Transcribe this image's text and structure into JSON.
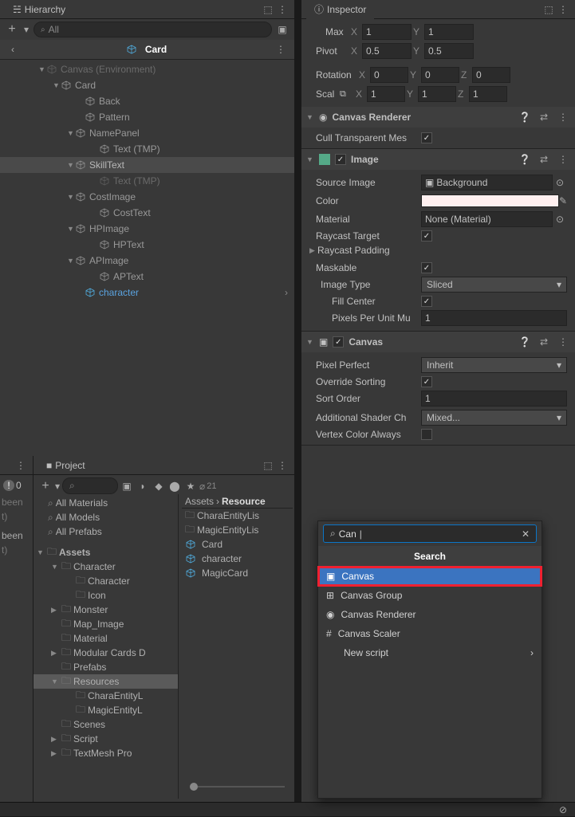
{
  "hierarchy": {
    "title": "Hierarchy",
    "search_placeholder": "All",
    "breadcrumb": "Card",
    "nodes": [
      {
        "label": "Canvas (Environment)",
        "indent": 48,
        "fold": true,
        "dim": true
      },
      {
        "label": "Card",
        "indent": 66,
        "fold": true
      },
      {
        "label": "Back",
        "indent": 96
      },
      {
        "label": "Pattern",
        "indent": 96
      },
      {
        "label": "NamePanel",
        "indent": 84,
        "fold": true
      },
      {
        "label": "Text (TMP)",
        "indent": 114
      },
      {
        "label": "SkillText",
        "indent": 84,
        "fold": true,
        "sel": true
      },
      {
        "label": "Text (TMP)",
        "indent": 114,
        "dim": true
      },
      {
        "label": "CostImage",
        "indent": 84,
        "fold": true
      },
      {
        "label": "CostText",
        "indent": 114
      },
      {
        "label": "HPImage",
        "indent": 84,
        "fold": true
      },
      {
        "label": "HPText",
        "indent": 114
      },
      {
        "label": "APImage",
        "indent": 84,
        "fold": true
      },
      {
        "label": "APText",
        "indent": 114
      },
      {
        "label": "character",
        "indent": 96,
        "active": true,
        "arrow": true
      }
    ]
  },
  "inspector": {
    "title": "Inspector",
    "transform": {
      "max_label": "Max",
      "x_label": "X",
      "y_label": "Y",
      "z_label": "Z",
      "max_x": "1",
      "max_y": "1",
      "pivot_label": "Pivot",
      "pivot_x": "0.5",
      "pivot_y": "0.5",
      "rotation_label": "Rotation",
      "rot_x": "0",
      "rot_y": "0",
      "rot_z": "0",
      "scale_label": "Scal",
      "scale_x": "1",
      "scale_y": "1",
      "scale_z": "1"
    },
    "canvas_renderer": {
      "title": "Canvas Renderer",
      "cull_label": "Cull Transparent Mes",
      "cull": true
    },
    "image": {
      "title": "Image",
      "source_image_label": "Source Image",
      "source_image": "Background",
      "color_label": "Color",
      "material_label": "Material",
      "material": "None (Material)",
      "raycast_target_label": "Raycast Target",
      "raycast_target": true,
      "raycast_padding_label": "Raycast Padding",
      "maskable_label": "Maskable",
      "maskable": true,
      "image_type_label": "Image Type",
      "image_type": "Sliced",
      "fill_center_label": "Fill Center",
      "fill_center": true,
      "ppum_label": "Pixels Per Unit Mu",
      "ppum": "1"
    },
    "canvas": {
      "title": "Canvas",
      "pixel_perfect_label": "Pixel Perfect",
      "pixel_perfect": "Inherit",
      "override_sorting_label": "Override Sorting",
      "override_sorting": true,
      "sort_order_label": "Sort Order",
      "sort_order": "1",
      "additional_shader_label": "Additional Shader Ch",
      "additional_shader": "Mixed...",
      "vertex_color_label": "Vertex Color Always"
    }
  },
  "search_popup": {
    "query": "Can",
    "header": "Search",
    "items": [
      {
        "label": "Canvas",
        "hl": true,
        "icon": "canvas"
      },
      {
        "label": "Canvas Group",
        "icon": "grid"
      },
      {
        "label": "Canvas Renderer",
        "icon": "eye"
      },
      {
        "label": "Canvas Scaler",
        "icon": "script"
      },
      {
        "label": "New script",
        "arrow": true
      }
    ]
  },
  "project": {
    "title": "Project",
    "visibility_count": "21",
    "favorites": [
      {
        "label": "All Materials"
      },
      {
        "label": "All Models"
      },
      {
        "label": "All Prefabs"
      }
    ],
    "assets_label": "Assets",
    "folders": [
      {
        "label": "Character",
        "indent": 18,
        "fold": true
      },
      {
        "label": "Character",
        "indent": 36
      },
      {
        "label": "Icon",
        "indent": 36
      },
      {
        "label": "Monster",
        "indent": 18,
        "foldc": true
      },
      {
        "label": "Map_Image",
        "indent": 18
      },
      {
        "label": "Material",
        "indent": 18
      },
      {
        "label": "Modular Cards D",
        "indent": 18,
        "foldc": true
      },
      {
        "label": "Prefabs",
        "indent": 18
      },
      {
        "label": "Resources",
        "indent": 18,
        "fold": true,
        "sel": true
      },
      {
        "label": "CharaEntityL",
        "indent": 36
      },
      {
        "label": "MagicEntityL",
        "indent": 36
      },
      {
        "label": "Scenes",
        "indent": 18
      },
      {
        "label": "Script",
        "indent": 18,
        "foldc": true
      },
      {
        "label": "TextMesh Pro",
        "indent": 18,
        "foldc": true
      }
    ],
    "breadcrumb_a": "Assets",
    "breadcrumb_b": "Resource",
    "items": [
      {
        "label": "CharaEntityLis",
        "type": "folder"
      },
      {
        "label": "MagicEntityLis",
        "type": "folder"
      },
      {
        "label": "Card",
        "type": "prefab"
      },
      {
        "label": "character",
        "type": "prefab"
      },
      {
        "label": "MagicCard",
        "type": "prefab"
      }
    ]
  },
  "console": {
    "err_count": "0",
    "line1": "been",
    "line2": "t)",
    "line3": "been",
    "line4": "t)"
  }
}
